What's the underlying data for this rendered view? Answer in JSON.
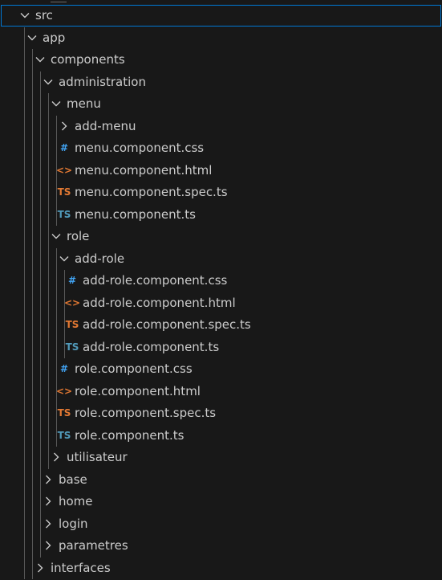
{
  "colors": {
    "css_icon": "#42a5f5",
    "html_icon": "#e37933",
    "ts_spec_icon": "#e37933",
    "ts_icon": "#519aba",
    "selection_border": "#0078d4"
  },
  "tree": [
    {
      "label": "src",
      "kind": "folder",
      "open": true,
      "depth": 0,
      "selected": true
    },
    {
      "label": "app",
      "kind": "folder",
      "open": true,
      "depth": 1
    },
    {
      "label": "components",
      "kind": "folder",
      "open": true,
      "depth": 2
    },
    {
      "label": "administration",
      "kind": "folder",
      "open": true,
      "depth": 3
    },
    {
      "label": "menu",
      "kind": "folder",
      "open": true,
      "depth": 4
    },
    {
      "label": "add-menu",
      "kind": "folder",
      "open": false,
      "depth": 5
    },
    {
      "label": "menu.component.css",
      "kind": "css",
      "depth": 5,
      "icon_text": "#"
    },
    {
      "label": "menu.component.html",
      "kind": "html",
      "depth": 5,
      "icon_text": "<>"
    },
    {
      "label": "menu.component.spec.ts",
      "kind": "spec",
      "depth": 5,
      "icon_text": "TS"
    },
    {
      "label": "menu.component.ts",
      "kind": "ts",
      "depth": 5,
      "icon_text": "TS"
    },
    {
      "label": "role",
      "kind": "folder",
      "open": true,
      "depth": 4
    },
    {
      "label": "add-role",
      "kind": "folder",
      "open": true,
      "depth": 5
    },
    {
      "label": "add-role.component.css",
      "kind": "css",
      "depth": 6,
      "icon_text": "#"
    },
    {
      "label": "add-role.component.html",
      "kind": "html",
      "depth": 6,
      "icon_text": "<>"
    },
    {
      "label": "add-role.component.spec.ts",
      "kind": "spec",
      "depth": 6,
      "icon_text": "TS"
    },
    {
      "label": "add-role.component.ts",
      "kind": "ts",
      "depth": 6,
      "icon_text": "TS"
    },
    {
      "label": "role.component.css",
      "kind": "css",
      "depth": 5,
      "icon_text": "#"
    },
    {
      "label": "role.component.html",
      "kind": "html",
      "depth": 5,
      "icon_text": "<>"
    },
    {
      "label": "role.component.spec.ts",
      "kind": "spec",
      "depth": 5,
      "icon_text": "TS"
    },
    {
      "label": "role.component.ts",
      "kind": "ts",
      "depth": 5,
      "icon_text": "TS"
    },
    {
      "label": "utilisateur",
      "kind": "folder",
      "open": false,
      "depth": 4
    },
    {
      "label": "base",
      "kind": "folder",
      "open": false,
      "depth": 3
    },
    {
      "label": "home",
      "kind": "folder",
      "open": false,
      "depth": 3
    },
    {
      "label": "login",
      "kind": "folder",
      "open": false,
      "depth": 3
    },
    {
      "label": "parametres",
      "kind": "folder",
      "open": false,
      "depth": 3
    },
    {
      "label": "interfaces",
      "kind": "folder",
      "open": false,
      "depth": 2
    }
  ]
}
